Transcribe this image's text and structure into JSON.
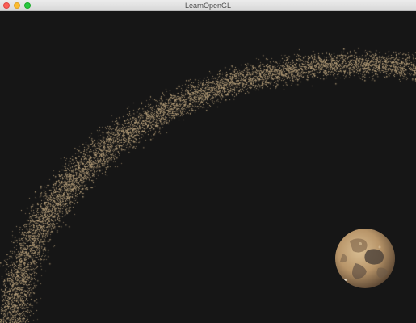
{
  "window": {
    "title": "LearnOpenGL"
  },
  "scene": {
    "background_color": "#161616",
    "asteroid_color": "#b8a07a",
    "planet_colors": [
      "#c4a57c",
      "#a98a63",
      "#6e5a45",
      "#3f3a36",
      "#e6d2b0"
    ]
  }
}
